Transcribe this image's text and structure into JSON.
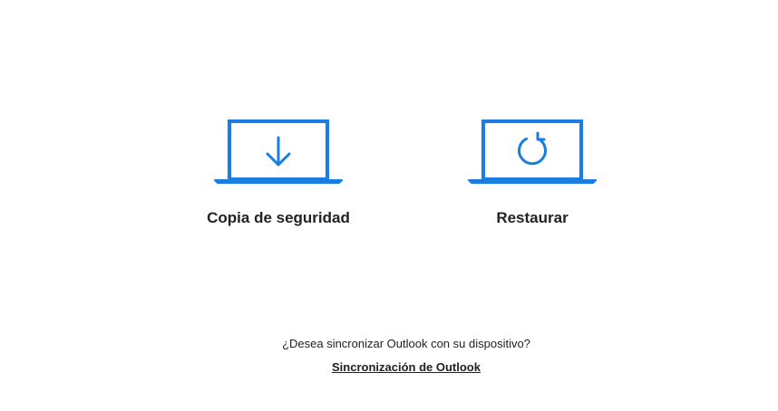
{
  "options": {
    "backup": {
      "label": "Copia de seguridad",
      "icon": "laptop-download-icon"
    },
    "restore": {
      "label": "Restaurar",
      "icon": "laptop-restore-icon"
    }
  },
  "sync": {
    "question": "¿Desea sincronizar Outlook con su dispositivo?",
    "link_label": "Sincronización de Outlook"
  },
  "colors": {
    "accent": "#1a7ee0",
    "text": "#222222",
    "background": "#ffffff"
  }
}
